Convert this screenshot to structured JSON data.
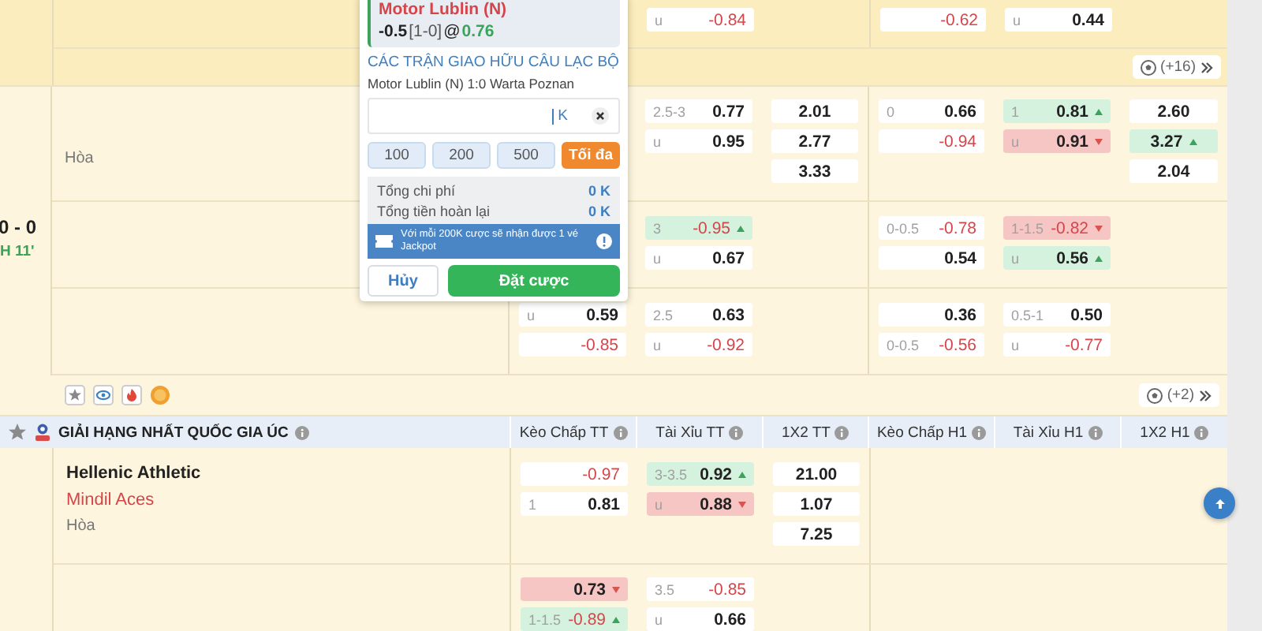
{
  "bet_slip": {
    "selection": "Motor Lublin (N)",
    "handicap": "-0.5",
    "score": "[1-0]",
    "at": "@",
    "odds": "0.76",
    "league": "CÁC TRẬN GIAO HỮU CÂU LẠC BỘ",
    "match": "Motor Lublin (N) 1:0 Warta Poznan",
    "stake_unit": "K",
    "quick_amounts": [
      {
        "label": "100",
        "kind": "amount"
      },
      {
        "label": "200",
        "kind": "amount"
      },
      {
        "label": "500",
        "kind": "amount"
      },
      {
        "label": "Tối đa",
        "kind": "max"
      }
    ],
    "totals": [
      {
        "label": "Tổng chi phí",
        "value": "0 K"
      },
      {
        "label": "Tổng tiền hoàn lại",
        "value": "0 K"
      }
    ],
    "promo": "Với mỗi 200K cược sẽ nhận được 1 vé Jackpot",
    "cancel_label": "Hủy",
    "submit_label": "Đặt cược"
  },
  "previous_match": {
    "more_markets": "(+16)",
    "odds": {
      "ou_ft": [
        {
          "line": "u",
          "odds": "-0.84",
          "negative": true
        }
      ],
      "hdp_h1": [
        {
          "odds": "-0.62",
          "negative": true
        }
      ],
      "ou_h1": [
        {
          "line": "u",
          "odds": "0.44",
          "negative": false
        }
      ]
    }
  },
  "live_match": {
    "score": "0 - 0",
    "clock": "H 11'",
    "draw_label": "Hòa",
    "more_markets": "(+2)",
    "lines": [
      {
        "ou_ft": [
          {
            "line": "2.5-3",
            "odds": "0.77",
            "negative": false
          },
          {
            "line": "u",
            "odds": "0.95",
            "negative": false
          }
        ],
        "x12_ft": [
          {
            "odds": "2.01",
            "negative": false
          },
          {
            "odds": "2.77",
            "negative": false
          },
          {
            "odds": "3.33",
            "negative": false
          }
        ],
        "hdp_h1": [
          {
            "line": "0",
            "odds": "0.66",
            "negative": false
          },
          {
            "odds": "-0.94",
            "negative": true
          }
        ],
        "ou_h1": [
          {
            "line": "1",
            "odds": "0.81",
            "negative": false,
            "rising": true
          },
          {
            "line": "u",
            "odds": "0.91",
            "negative": false,
            "rising": false
          }
        ],
        "x12_h1": [
          {
            "odds": "2.60",
            "negative": false
          },
          {
            "odds": "3.27",
            "negative": false,
            "rising": true
          },
          {
            "odds": "2.04",
            "negative": false
          }
        ]
      },
      {
        "ou_ft": [
          {
            "line": "3",
            "odds": "-0.95",
            "negative": true,
            "rising": true
          },
          {
            "line": "u",
            "odds": "0.67",
            "negative": false
          }
        ],
        "hdp_h1": [
          {
            "line": "0-0.5",
            "odds": "-0.78",
            "negative": true
          },
          {
            "odds": "0.54",
            "negative": false
          }
        ],
        "ou_h1": [
          {
            "line": "1-1.5",
            "odds": "-0.82",
            "negative": true,
            "rising": false
          },
          {
            "line": "u",
            "odds": "0.56",
            "negative": false,
            "rising": true
          }
        ]
      },
      {
        "hdp_ft": [
          {
            "line": "u",
            "odds": "0.59",
            "negative": false
          },
          {
            "odds": "-0.85",
            "negative": true
          }
        ],
        "ou_ft": [
          {
            "line": "2.5",
            "odds": "0.63",
            "negative": false
          },
          {
            "line": "u",
            "odds": "-0.92",
            "negative": true
          }
        ],
        "hdp_h1": [
          {
            "odds": "0.36",
            "negative": false
          },
          {
            "line": "0-0.5",
            "odds": "-0.56",
            "negative": true
          }
        ],
        "ou_h1": [
          {
            "line": "0.5-1",
            "odds": "0.50",
            "negative": false
          },
          {
            "line": "u",
            "odds": "-0.77",
            "negative": true
          }
        ]
      }
    ]
  },
  "league": {
    "name": "GIẢI HẠNG NHẤT QUỐC GIA ÚC",
    "columns": [
      "Kèo Chấp TT",
      "Tài Xỉu TT",
      "1X2 TT",
      "Kèo Chấp H1",
      "Tài Xỉu H1",
      "1X2 H1"
    ],
    "matches": [
      {
        "home": "Hellenic Athletic",
        "away": "Mindil Aces",
        "draw_label": "Hòa",
        "lines": [
          {
            "hdp_ft": [
              {
                "odds": "-0.97",
                "negative": true
              },
              {
                "line": "1",
                "odds": "0.81",
                "negative": false
              }
            ],
            "ou_ft": [
              {
                "line": "3-3.5",
                "odds": "0.92",
                "negative": false,
                "rising": true
              },
              {
                "line": "u",
                "odds": "0.88",
                "negative": false,
                "rising": false
              }
            ],
            "x12_ft": [
              {
                "odds": "21.00",
                "negative": false
              },
              {
                "odds": "1.07",
                "negative": false
              },
              {
                "odds": "7.25",
                "negative": false
              }
            ]
          },
          {
            "hdp_ft": [
              {
                "odds": "0.73",
                "negative": false,
                "rising": false
              },
              {
                "line": "1-1.5",
                "odds": "-0.89",
                "negative": true,
                "rising": true
              }
            ],
            "ou_ft": [
              {
                "line": "3.5",
                "odds": "-0.85",
                "negative": true
              },
              {
                "line": "u",
                "odds": "0.66",
                "negative": false
              }
            ]
          }
        ]
      }
    ]
  }
}
